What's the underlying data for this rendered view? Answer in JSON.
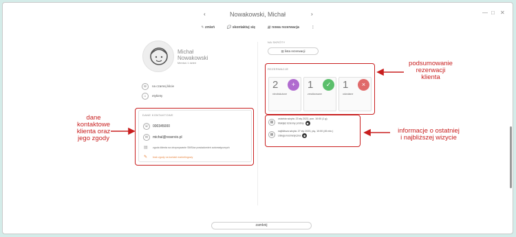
{
  "window": {
    "title": "Nowakowski, Michał",
    "prev_arrow": "‹",
    "next_arrow": "›"
  },
  "toolbar": {
    "edit_label": "zmień",
    "contact_label": "skontaktuj się",
    "new_reservation_label": "nowa rezerwacja",
    "more_label": "⋮"
  },
  "client": {
    "first_name": "Michał",
    "last_name": "Nowakowski",
    "member_since": "Mentuś 1 dzień",
    "blacklist_label": "na czarnej liście",
    "tags_label": "etykiety"
  },
  "contact": {
    "section_title": "DANE KONTAKTOWE",
    "phone": "000345000",
    "email": "michal@reservio.pl",
    "sms_consent": "zgoda klienta na otrzymywanie SMSów powiadomień automatycznych",
    "marketing_consent": "brak zgody na kontakt marketingowy"
  },
  "shortcuts": {
    "section_title": "NA SKRÓTY",
    "reservation_list_label": "lista rezerwacji"
  },
  "reservations": {
    "section_title": "REZERWACJE",
    "tiles": [
      {
        "count": "2",
        "label": "nieobsłużone",
        "color": "#b06bcf",
        "icon": "+"
      },
      {
        "count": "1",
        "label": "zrealizowane",
        "color": "#5bbf6b",
        "icon": "✓"
      },
      {
        "count": "1",
        "label": "odwołane",
        "color": "#e06a6a",
        "icon": "×"
      }
    ]
  },
  "visits": {
    "last_line1": "ostatnia wizyta: 23 sty 2023, pon. 10:00 (1 g)",
    "last_line2": "Makijaż dzienny próbny",
    "next_line1": "najbliższa wizyta: 27 sty 2023, pią. 10:00 (45 min.)",
    "next_line2": "Usługa kosmetyczna"
  },
  "annotations": {
    "contact_note": "dane\nkontaktowe\nklienta oraz\njego zgody",
    "summary_note": "podsumowanie\nrezerwacji\nklienta",
    "visits_note": "informacje o ostatniej\ni najbliższej wizycie"
  },
  "footer": {
    "close_label": "zamknij"
  },
  "colors": {
    "annotation_red": "#c81e1e",
    "marketing_orange": "#e8823a"
  }
}
